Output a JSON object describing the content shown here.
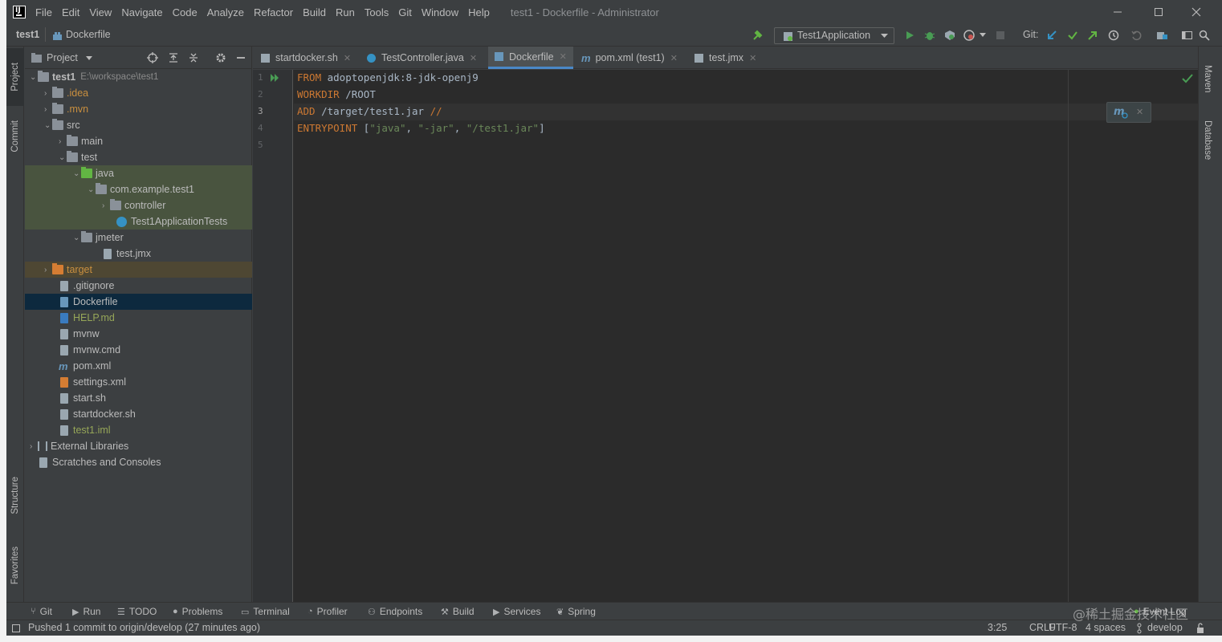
{
  "titlebar": {
    "menu": [
      "File",
      "Edit",
      "View",
      "Navigate",
      "Code",
      "Analyze",
      "Refactor",
      "Build",
      "Run",
      "Tools",
      "Git",
      "Window",
      "Help"
    ],
    "window_title": "test1 - Dockerfile - Administrator"
  },
  "navbar": {
    "project": "test1",
    "file": "Dockerfile",
    "run_config": "Test1Application",
    "git_label": "Git:"
  },
  "left_strip": [
    "Project",
    "Commit",
    "Structure",
    "Favorites"
  ],
  "right_strip": [
    "Maven",
    "Database"
  ],
  "project_panel": {
    "title": "Project",
    "tree": [
      {
        "label": "test1",
        "path": "E:\\workspace\\test1"
      },
      {
        "label": ".idea"
      },
      {
        "label": ".mvn"
      },
      {
        "label": "src"
      },
      {
        "label": "main"
      },
      {
        "label": "test"
      },
      {
        "label": "java"
      },
      {
        "label": "com.example.test1"
      },
      {
        "label": "controller"
      },
      {
        "label": "Test1ApplicationTests"
      },
      {
        "label": "jmeter"
      },
      {
        "label": "test.jmx"
      },
      {
        "label": "target"
      },
      {
        "label": ".gitignore"
      },
      {
        "label": "Dockerfile"
      },
      {
        "label": "HELP.md"
      },
      {
        "label": "mvnw"
      },
      {
        "label": "mvnw.cmd"
      },
      {
        "label": "pom.xml"
      },
      {
        "label": "settings.xml"
      },
      {
        "label": "start.sh"
      },
      {
        "label": "startdocker.sh"
      },
      {
        "label": "test1.iml"
      },
      {
        "label": "External Libraries"
      },
      {
        "label": "Scratches and Consoles"
      }
    ]
  },
  "editor_tabs": [
    "startdocker.sh",
    "TestController.java",
    "Dockerfile",
    "pom.xml (test1)",
    "test.jmx"
  ],
  "editor": {
    "line_numbers": [
      "1",
      "2",
      "3",
      "4",
      "5"
    ],
    "lines": [
      {
        "kw": "FROM",
        "rest": " adoptopenjdk:8-jdk-openj9"
      },
      {
        "kw": "WORKDIR",
        "rest": " /ROOT"
      },
      {
        "kw": "ADD",
        "rest": " /target/test1.jar ",
        "cmt": "//"
      },
      {
        "kw": "ENTRYPOINT",
        "p1": " [",
        "s1": "\"java\"",
        "p2": ", ",
        "s2": "\"-jar\"",
        "p3": ", ",
        "s3": "\"/test1.jar\"",
        "p4": "]"
      }
    ]
  },
  "bottom_tools": [
    "Git",
    "Run",
    "TODO",
    "Problems",
    "Terminal",
    "Profiler",
    "Endpoints",
    "Build",
    "Services",
    "Spring",
    "Event Log"
  ],
  "status": {
    "message": "Pushed 1 commit to origin/develop (27 minutes ago)",
    "position": "3:25",
    "line_sep": "CRLF",
    "encoding": "UTF-8",
    "indent": "4 spaces",
    "branch": "develop"
  },
  "watermark": "@稀土掘金技术社区"
}
